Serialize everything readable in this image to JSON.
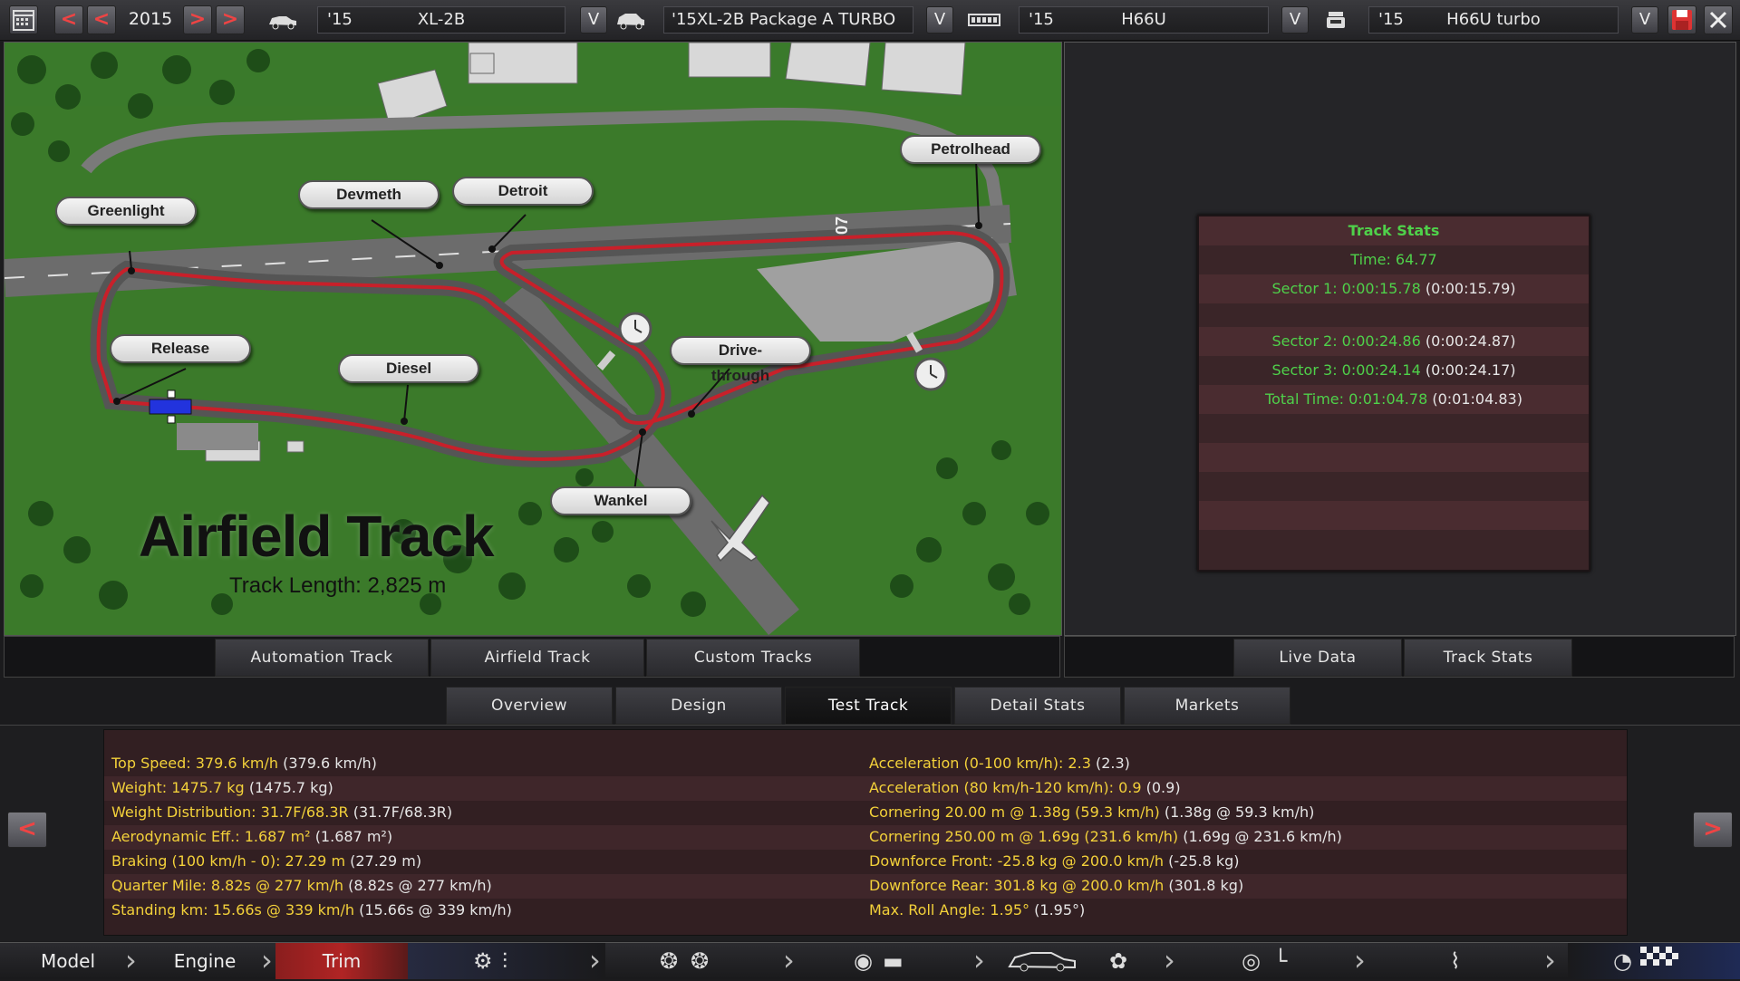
{
  "topbar": {
    "year": "2015",
    "model": {
      "year": "'15",
      "name": "XL-2B"
    },
    "trim": {
      "name": "'15XL-2B Package A TURBO"
    },
    "engine": {
      "year": "'15",
      "name": "H66U"
    },
    "variant": {
      "year": "'15",
      "name": "H66U turbo"
    },
    "prev_label": "<",
    "next_label": ">",
    "dropdown_label": "V"
  },
  "map": {
    "title": "Airfield Track",
    "length": "Track Length: 2,825 m",
    "runway_marking": "07",
    "waypoints": [
      "Greenlight",
      "Devmeth",
      "Detroit",
      "Petrolhead",
      "Release",
      "Diesel",
      "Drive-through",
      "Wankel"
    ]
  },
  "map_tabs": [
    "Automation Track",
    "Airfield Track",
    "Custom Tracks"
  ],
  "right_tabs": [
    "Live Data",
    "Track Stats"
  ],
  "track_stats": {
    "title": "Track Stats",
    "time": "Time: 64.77",
    "sector1": {
      "value": "Sector 1: 0:00:15.78",
      "ref": "(0:00:15.79)"
    },
    "sector2": {
      "value": "Sector 2: 0:00:24.86",
      "ref": "(0:00:24.87)"
    },
    "sector3": {
      "value": "Sector 3: 0:00:24.14",
      "ref": "(0:00:24.17)"
    },
    "total": {
      "value": "Total Time: 0:01:04.78",
      "ref": "(0:01:04.83)"
    }
  },
  "main_tabs": [
    "Overview",
    "Design",
    "Test Track",
    "Detail Stats",
    "Markets"
  ],
  "details_left": [
    {
      "k": "Top Speed: 379.6 km/h",
      "v": "(379.6 km/h)"
    },
    {
      "k": "Weight: 1475.7 kg",
      "v": "(1475.7 kg)"
    },
    {
      "k": "Weight Distribution: 31.7F/68.3R",
      "v": "(31.7F/68.3R)"
    },
    {
      "k": "Aerodynamic Eff.: 1.687 m²",
      "v": "(1.687 m²)"
    },
    {
      "k": "Braking (100 km/h - 0): 27.29 m",
      "v": "(27.29 m)"
    },
    {
      "k": "Quarter Mile: 8.82s @ 277 km/h",
      "v": "(8.82s @ 277 km/h)"
    },
    {
      "k": "Standing km: 15.66s @ 339 km/h",
      "v": "(15.66s @ 339 km/h)"
    }
  ],
  "details_right": [
    {
      "k": "Acceleration (0-100 km/h): 2.3",
      "v": "(2.3)"
    },
    {
      "k": "Acceleration (80 km/h-120 km/h): 0.9",
      "v": "(0.9)"
    },
    {
      "k": "Cornering 20.00 m @ 1.38g (59.3 km/h)",
      "v": "(1.38g @ 59.3 km/h)"
    },
    {
      "k": "Cornering 250.00 m @ 1.69g (231.6 km/h)",
      "v": "(1.69g @ 231.6 km/h)"
    },
    {
      "k": "Downforce Front: -25.8 kg @ 200.0 km/h",
      "v": "(-25.8 kg)"
    },
    {
      "k": "Downforce Rear: 301.8 kg @ 200.0 km/h",
      "v": "(301.8 kg)"
    },
    {
      "k": "Max. Roll Angle: 1.95°",
      "v": "(1.95°)"
    }
  ],
  "bottom_nav": {
    "model": "Model",
    "engine": "Engine",
    "trim": "Trim"
  },
  "colors": {
    "accent_red": "#e33b3b",
    "stat_green": "#4fd14a",
    "stat_yellow": "#f3d13a",
    "track_red": "#c8202a"
  }
}
